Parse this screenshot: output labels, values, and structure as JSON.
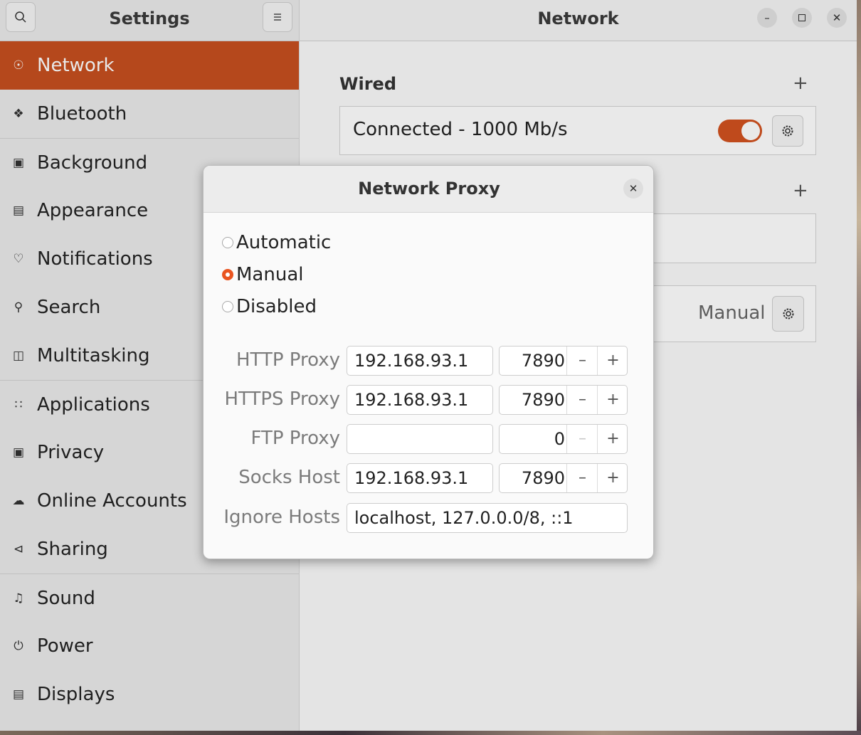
{
  "sidebar": {
    "title": "Settings",
    "items": [
      {
        "label": "Network",
        "icon": "globe-icon"
      },
      {
        "label": "Bluetooth",
        "icon": "bluetooth-icon"
      },
      {
        "label": "Background",
        "icon": "monitor-icon"
      },
      {
        "label": "Appearance",
        "icon": "appearance-icon"
      },
      {
        "label": "Notifications",
        "icon": "bell-icon"
      },
      {
        "label": "Search",
        "icon": "search-icon"
      },
      {
        "label": "Multitasking",
        "icon": "multitasking-icon"
      },
      {
        "label": "Applications",
        "icon": "grid-icon"
      },
      {
        "label": "Privacy",
        "icon": "lock-icon"
      },
      {
        "label": "Online Accounts",
        "icon": "cloud-icon"
      },
      {
        "label": "Sharing",
        "icon": "share-icon"
      },
      {
        "label": "Sound",
        "icon": "music-note-icon"
      },
      {
        "label": "Power",
        "icon": "power-icon"
      },
      {
        "label": "Displays",
        "icon": "display-icon"
      }
    ],
    "active_item": "Network"
  },
  "main": {
    "title": "Network",
    "wired": {
      "title": "Wired",
      "status": "Connected - 1000 Mb/s",
      "enabled": true
    },
    "proxy_row": {
      "value": "Manual"
    }
  },
  "dialog": {
    "title": "Network Proxy",
    "options": [
      "Automatic",
      "Manual",
      "Disabled"
    ],
    "selected": "Manual",
    "fields": [
      {
        "label": "HTTP Proxy",
        "host": "192.168.93.1",
        "port": "7890"
      },
      {
        "label": "HTTPS Proxy",
        "host": "192.168.93.1",
        "port": "7890"
      },
      {
        "label": "FTP Proxy",
        "host": "",
        "port": "0"
      },
      {
        "label": "Socks Host",
        "host": "192.168.93.1",
        "port": "7890"
      }
    ],
    "ignore_hosts": {
      "label": "Ignore Hosts",
      "value": "localhost, 127.0.0.0/8, ::1"
    }
  },
  "colors": {
    "accent": "#e95420",
    "active_sidebar": "#c74f1f"
  }
}
